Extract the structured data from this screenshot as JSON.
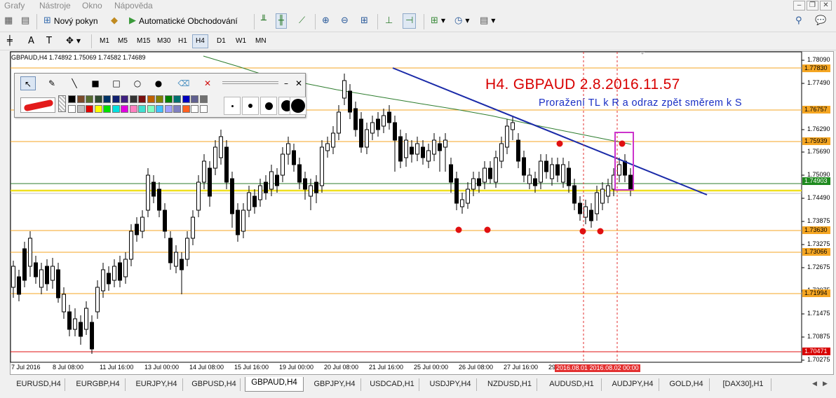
{
  "menu": {
    "items": [
      "Grafy",
      "Nástroje",
      "Okno",
      "Nápověda"
    ]
  },
  "toolbar": {
    "new_order_label": "Nový pokyn",
    "autotrading_label": "Automatické Obchodování"
  },
  "timeframes": [
    "M1",
    "M5",
    "M15",
    "M30",
    "H1",
    "H4",
    "D1",
    "W1",
    "MN"
  ],
  "active_timeframe": "H4",
  "chart": {
    "header": "GBPAUD,H4  1.74892 1.75069 1.74582 1.74689",
    "annotation_title": "H4. GBPAUD 2.8.2016.11.57",
    "annotation_subtitle": "Proražení TL k R a odraz zpět směrem k S",
    "price_labels": [
      "1.78090",
      "1.77490",
      "1.76290",
      "1.75690",
      "1.75090",
      "1.74490",
      "1.73875",
      "1.73275",
      "1.72675",
      "1.72075",
      "1.71475",
      "1.70875",
      "1.70275"
    ],
    "level_labels": [
      {
        "value": "1.77830",
        "color": "#f5a623"
      },
      {
        "value": "1.76757",
        "color": "#f5a623"
      },
      {
        "value": "1.75939",
        "color": "#f5a623"
      },
      {
        "value": "1.74903",
        "color": "#1e8a1e"
      },
      {
        "value": "1.73630",
        "color": "#f5a623"
      },
      {
        "value": "1.73066",
        "color": "#f5a623"
      },
      {
        "value": "1.71994",
        "color": "#f5a623"
      },
      {
        "value": "1.70471",
        "color": "#d80000"
      }
    ],
    "time_labels": [
      "7 Jul 2016",
      "8 Jul 08:00",
      "11 Jul 16:00",
      "13 Jul 00:00",
      "14 Jul 08:00",
      "15 Jul 16:00",
      "19 Jul 00:00",
      "20 Jul 08:00",
      "21 Jul 16:00",
      "25 Jul 00:00",
      "26 Jul 08:00",
      "27 Jul 16:00",
      "29"
    ],
    "date_highlight": "2016.08.01 2016.08.02 00:00",
    "colors": {
      "trendline": "#1a2aa8",
      "support_resistance": "#f5a623",
      "ma_line": "#2e7d2e",
      "marker": "#e01010",
      "box": "#cc33cc"
    }
  },
  "tabs": [
    {
      "label": "EURUSD,H4"
    },
    {
      "label": "EURGBP,H4"
    },
    {
      "label": "EURJPY,H4"
    },
    {
      "label": "GBPUSD,H4"
    },
    {
      "label": "GBPAUD,H4",
      "active": true
    },
    {
      "label": "GBPJPY,H4"
    },
    {
      "label": "USDCAD,H1"
    },
    {
      "label": "USDJPY,H4"
    },
    {
      "label": "NZDUSD,H1"
    },
    {
      "label": "AUDUSD,H1"
    },
    {
      "label": "AUDJPY,H4"
    },
    {
      "label": "GOLD,H4"
    },
    {
      "label": "[DAX30],H1"
    }
  ],
  "icons": {
    "search": "search-icon",
    "chat": "chat-icon"
  }
}
